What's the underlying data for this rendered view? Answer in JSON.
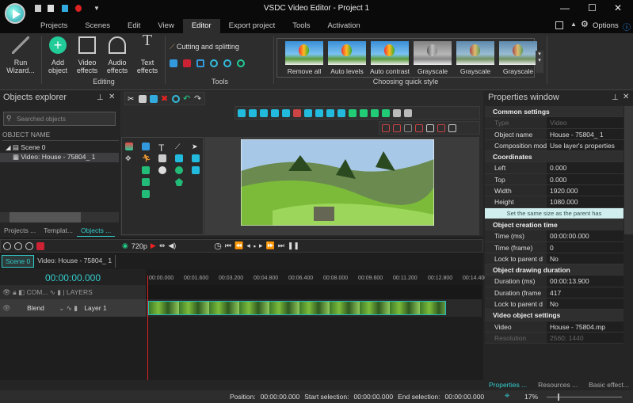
{
  "window": {
    "title": "VSDC Video Editor - Project 1",
    "minimize": "—",
    "maximize": "☐",
    "close": "✕"
  },
  "menu_tabs": [
    "Projects",
    "Scenes",
    "Edit",
    "View",
    "Editor",
    "Export project",
    "Tools",
    "Activation"
  ],
  "options_label": "Options",
  "ribbon": {
    "run_wizard": "Run Wizard...",
    "editing": {
      "label": "Editing",
      "buttons": [
        "Add object",
        "Video effects",
        "Audio effects",
        "Text effects"
      ]
    },
    "tools": {
      "label": "Tools",
      "cutting": "Cutting and splitting"
    },
    "quick_style": {
      "label": "Choosing quick style",
      "items": [
        "Remove all",
        "Auto levels",
        "Auto contrast",
        "Grayscale",
        "Grayscale",
        "Grayscale"
      ]
    }
  },
  "objects_explorer": {
    "title": "Objects explorer",
    "search_placeholder": "Searched objects",
    "column": "OBJECT NAME",
    "tree": [
      "Scene 0",
      "Video: House - 75804_ 1"
    ],
    "tabs": [
      "Projects ...",
      "Templat...",
      "Objects ..."
    ]
  },
  "timeline": {
    "resolution": "720p",
    "tabs": [
      "Scene 0",
      "Video: House - 75804_ 1"
    ],
    "time": "00:00:00.000",
    "ruler": [
      "00:00.000",
      "00:01.600",
      "00:03.200",
      "00:04.800",
      "00:06.400",
      "00:08.000",
      "00:09.600",
      "00:11.200",
      "00:12.800",
      "00:14.400"
    ],
    "header": {
      "com": "COM...",
      "layers": "LAYERS"
    },
    "layer": {
      "blend": "Blend",
      "name": "Layer 1"
    }
  },
  "properties": {
    "title": "Properties window",
    "rows": [
      {
        "type": "sec",
        "k": "Common settings"
      },
      {
        "type": "dis",
        "k": "Type",
        "v": "Video"
      },
      {
        "k": "Object name",
        "v": "House - 75804_ 1"
      },
      {
        "k": "Composition mod",
        "v": "Use layer's properties"
      },
      {
        "type": "sec",
        "k": "Coordinates"
      },
      {
        "k": "Left",
        "v": "0.000"
      },
      {
        "k": "Top",
        "v": "0.000"
      },
      {
        "k": "Width",
        "v": "1920.000"
      },
      {
        "k": "Height",
        "v": "1080.000"
      },
      {
        "type": "hint",
        "k": "Set the same size as the parent has"
      },
      {
        "type": "sec",
        "k": "Object creation time"
      },
      {
        "k": "Time (ms)",
        "v": "00:00:00.000"
      },
      {
        "k": "Time (frame)",
        "v": "0"
      },
      {
        "k": "Lock to parent d",
        "v": "No"
      },
      {
        "type": "sec",
        "k": "Object drawing duration"
      },
      {
        "k": "Duration (ms)",
        "v": "00:00:13.900"
      },
      {
        "k": "Duration (frame",
        "v": "417"
      },
      {
        "k": "Lock to parent d",
        "v": "No"
      },
      {
        "type": "sec",
        "k": "Video object settings"
      },
      {
        "k": "Video",
        "v": "House - 75804.mp"
      },
      {
        "type": "dis",
        "k": "Resolution",
        "v": "2560; 1440"
      }
    ],
    "tabs": [
      "Properties ...",
      "Resources ...",
      "Basic effect..."
    ]
  },
  "status": {
    "position_label": "Position:",
    "position": "00:00:00.000",
    "start_label": "Start selection:",
    "start": "00:00:00.000",
    "end_label": "End selection:",
    "end": "00:00:00.000",
    "zoom": "17%"
  },
  "colors": {
    "accent": "#33cccc",
    "bg": "#252526"
  }
}
